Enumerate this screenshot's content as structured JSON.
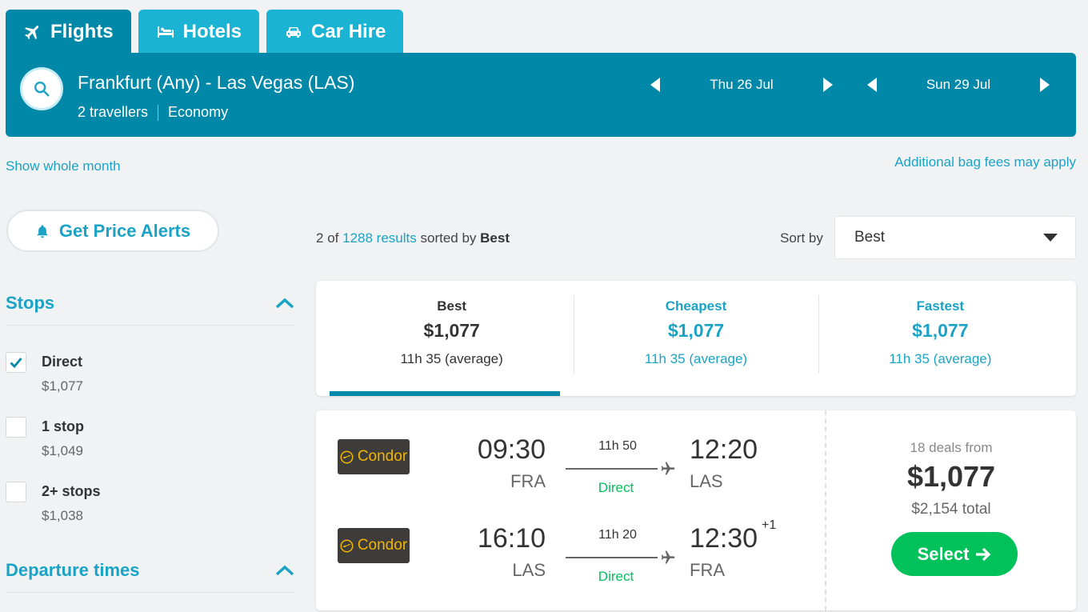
{
  "tabs": [
    {
      "label": "Flights",
      "icon": "plane-icon",
      "active": true
    },
    {
      "label": "Hotels",
      "icon": "bed-icon",
      "active": false
    },
    {
      "label": "Car Hire",
      "icon": "car-icon",
      "active": false
    }
  ],
  "search": {
    "route": "Frankfurt (Any) - Las Vegas (LAS)",
    "travellers": "2 travellers",
    "cabin": "Economy",
    "outbound_date": "Thu 26 Jul",
    "return_date": "Sun 29 Jul"
  },
  "links": {
    "show_month": "Show whole month",
    "bag_fees": "Additional bag fees may apply"
  },
  "price_alerts_label": "Get Price Alerts",
  "filters": {
    "stops_title": "Stops",
    "departure_title": "Departure times",
    "options": [
      {
        "label": "Direct",
        "price": "$1,077",
        "checked": true
      },
      {
        "label": "1 stop",
        "price": "$1,049",
        "checked": false
      },
      {
        "label": "2+ stops",
        "price": "$1,038",
        "checked": false
      }
    ]
  },
  "results": {
    "shown": "2",
    "of_word": "of",
    "total_link": "1288 results",
    "sorted_by_text": "sorted by",
    "sorted_by_value": "Best",
    "sort_label": "Sort by",
    "sort_value": "Best"
  },
  "sort_tabs": [
    {
      "label": "Best",
      "price": "$1,077",
      "duration": "11h 35 (average)"
    },
    {
      "label": "Cheapest",
      "price": "$1,077",
      "duration": "11h 35 (average)"
    },
    {
      "label": "Fastest",
      "price": "$1,077",
      "duration": "11h 35 (average)"
    }
  ],
  "itinerary": {
    "legs": [
      {
        "airline": "Condor",
        "dep_time": "09:30",
        "dep_code": "FRA",
        "duration": "11h 50",
        "stops": "Direct",
        "arr_time": "12:20",
        "arr_code": "LAS",
        "plus_day": ""
      },
      {
        "airline": "Condor",
        "dep_time": "16:10",
        "dep_code": "LAS",
        "duration": "11h 20",
        "stops": "Direct",
        "arr_time": "12:30",
        "arr_code": "FRA",
        "plus_day": "+1"
      }
    ],
    "deals": "18 deals from",
    "price": "$1,077",
    "total": "$2,154 total",
    "select_label": "Select"
  },
  "colors": {
    "brand_dark": "#0088a8",
    "brand_light": "#1ab3d3",
    "link": "#1aa3c4",
    "success": "#00c15a",
    "airline_logo_bg": "#3d3c3a",
    "airline_logo_text": "#f2b600"
  }
}
